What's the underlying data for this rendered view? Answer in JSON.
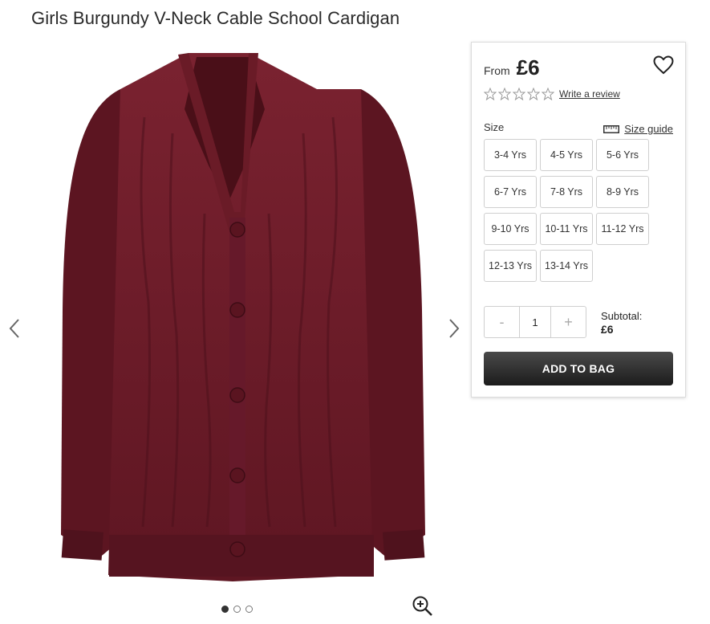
{
  "product": {
    "title": "Girls Burgundy V-Neck Cable School Cardigan",
    "image_name": "burgundy-cardigan",
    "color": "#6b1a26"
  },
  "gallery": {
    "dots": [
      true,
      false,
      false
    ]
  },
  "panel": {
    "price_prefix": "From",
    "price": "£6",
    "rating": 0,
    "rating_max": 5,
    "review_link": "Write a review",
    "size_label": "Size",
    "size_guide": "Size guide",
    "sizes": [
      "3-4 Yrs",
      "4-5 Yrs",
      "5-6 Yrs",
      "6-7 Yrs",
      "7-8 Yrs",
      "8-9 Yrs",
      "9-10 Yrs",
      "10-11 Yrs",
      "11-12 Yrs",
      "12-13 Yrs",
      "13-14 Yrs"
    ],
    "quantity": {
      "minus": "-",
      "value": "1",
      "plus": "+"
    },
    "subtotal_label": "Subtotal:",
    "subtotal_value": "£6",
    "add_to_bag": "ADD TO BAG"
  },
  "icons": {
    "heart": "heart-icon",
    "star": "star-outline-icon",
    "ruler": "ruler-icon",
    "zoom": "zoom-in-icon",
    "prev": "chevron-left-icon",
    "next": "chevron-right-icon"
  }
}
